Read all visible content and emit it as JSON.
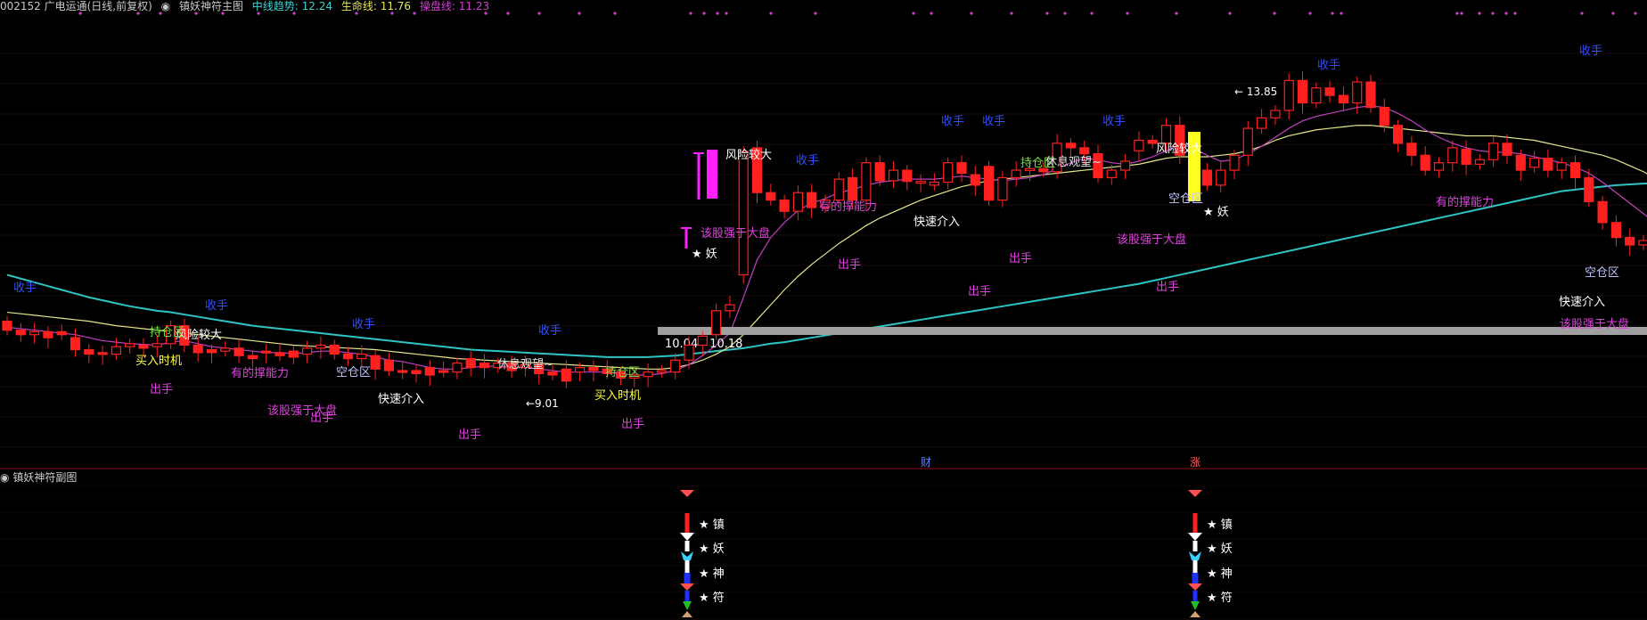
{
  "header": {
    "stock": "002152 广电运通(日线,前复权)",
    "indicator": "镇妖神符主图",
    "mid_trend": "中线趋势: 12.24",
    "life_line": "生命线: 11.76",
    "operate_line": "操盘线: 11.23"
  },
  "sub_chart_title": "镇妖神符副图",
  "range_label": "10.04 - 10.18",
  "price_high": "← 13.85",
  "price_low": "←9.01",
  "markers": {
    "cai": "财",
    "zhang": "涨"
  },
  "sub_labels": [
    "★ 镇",
    "★ 妖",
    "★ 神",
    "★ 符"
  ],
  "colors": {
    "up": "#ff2020",
    "down": "#ff2020",
    "cyan_line": "#2ec4c4",
    "yellow_line": "#e6e68c",
    "magenta_line": "#c040c0",
    "range_bar": "#a0a0a0",
    "header_mid": "#3ed0d0",
    "header_life": "#e6e65a",
    "header_op": "#d040d0"
  },
  "annotations": [
    {
      "text": "收手",
      "color": "#3050ff"
    },
    {
      "text": "收手",
      "color": "#3050ff"
    },
    {
      "text": "收手",
      "color": "#3050ff"
    },
    {
      "text": "收手",
      "color": "#3050ff"
    },
    {
      "text": "收手",
      "color": "#3050ff"
    },
    {
      "text": "收手",
      "color": "#3050ff"
    },
    {
      "text": "收手",
      "color": "#3050ff"
    },
    {
      "text": "收手",
      "color": "#3050ff"
    },
    {
      "text": "收手",
      "color": "#3050ff"
    },
    {
      "text": "收手",
      "color": "#3050ff"
    },
    {
      "text": "出手",
      "color": "#e040e0"
    },
    {
      "text": "出手",
      "color": "#e040e0"
    },
    {
      "text": "出手",
      "color": "#e040e0"
    },
    {
      "text": "出手",
      "color": "#e040e0"
    },
    {
      "text": "出手",
      "color": "#e040e0"
    },
    {
      "text": "出手",
      "color": "#e040e0"
    },
    {
      "text": "出手",
      "color": "#e040e0"
    },
    {
      "text": "出手",
      "color": "#e040e0"
    },
    {
      "text": "风险较大",
      "color": "#ffffff"
    },
    {
      "text": "风险较大",
      "color": "#ffffff"
    },
    {
      "text": "风险较大",
      "color": "#ffffff"
    },
    {
      "text": "持仓区",
      "color": "#70e040"
    },
    {
      "text": "持仓区",
      "color": "#70e040"
    },
    {
      "text": "持仓区",
      "color": "#70e040"
    },
    {
      "text": "空仓区",
      "color": "#c0c0ff"
    },
    {
      "text": "空仓区",
      "color": "#c0c0ff"
    },
    {
      "text": "空仓区",
      "color": "#c0c0ff"
    },
    {
      "text": "买入时机",
      "color": "#ffff40"
    },
    {
      "text": "买入时机",
      "color": "#ffff40"
    },
    {
      "text": "快速介入",
      "color": "#ffffff"
    },
    {
      "text": "快速介入",
      "color": "#ffffff"
    },
    {
      "text": "快速介入",
      "color": "#ffffff"
    },
    {
      "text": "休息观望~",
      "color": "#e0e0e0"
    },
    {
      "text": "休息观望~",
      "color": "#e0e0e0"
    },
    {
      "text": "该股强于大盘",
      "color": "#e040e0"
    },
    {
      "text": "该股强于大盘",
      "color": "#e040e0"
    },
    {
      "text": "该股强于大盘",
      "color": "#e040e0"
    },
    {
      "text": "该股强于大盘",
      "color": "#e040e0"
    },
    {
      "text": "有的撑能力",
      "color": "#e040e0"
    },
    {
      "text": "有的撑能力",
      "color": "#e040e0"
    },
    {
      "text": "有的撑能力",
      "color": "#e040e0"
    },
    {
      "text": "★ 妖",
      "color": "#ffffff"
    },
    {
      "text": "★ 妖",
      "color": "#ffffff"
    }
  ],
  "chart_data": {
    "type": "candlestick",
    "price_range": [
      8.6,
      14.2
    ],
    "candles": [
      [
        10.38,
        10.26
      ],
      [
        10.26,
        10.2
      ],
      [
        10.2,
        10.24
      ],
      [
        10.24,
        10.16
      ],
      [
        10.24,
        10.2
      ],
      [
        10.16,
        10.0
      ],
      [
        10.0,
        9.94
      ],
      [
        9.96,
        9.94
      ],
      [
        9.94,
        10.04
      ],
      [
        10.04,
        10.08
      ],
      [
        10.06,
        10.02
      ],
      [
        10.04,
        10.08
      ],
      [
        10.08,
        10.32
      ],
      [
        10.32,
        10.06
      ],
      [
        10.06,
        9.96
      ],
      [
        10.0,
        9.96
      ],
      [
        9.98,
        10.02
      ],
      [
        10.02,
        9.92
      ],
      [
        9.92,
        9.88
      ],
      [
        9.98,
        9.96
      ],
      [
        9.96,
        9.92
      ],
      [
        9.98,
        9.9
      ],
      [
        9.94,
        10.02
      ],
      [
        10.02,
        10.06
      ],
      [
        10.06,
        9.94
      ],
      [
        9.94,
        9.88
      ],
      [
        9.88,
        9.94
      ],
      [
        9.92,
        9.74
      ],
      [
        9.86,
        9.72
      ],
      [
        9.72,
        9.7
      ],
      [
        9.72,
        9.68
      ],
      [
        9.76,
        9.66
      ],
      [
        9.72,
        9.7
      ],
      [
        9.7,
        9.82
      ],
      [
        9.88,
        9.76
      ],
      [
        9.82,
        9.76
      ],
      [
        9.76,
        9.82
      ],
      [
        9.82,
        9.72
      ],
      [
        9.76,
        9.8
      ],
      [
        9.8,
        9.68
      ],
      [
        9.7,
        9.66
      ],
      [
        9.74,
        9.58
      ],
      [
        9.7,
        9.76
      ],
      [
        9.76,
        9.72
      ],
      [
        9.74,
        9.68
      ],
      [
        9.7,
        9.62
      ],
      [
        9.62,
        9.66
      ],
      [
        9.64,
        9.7
      ],
      [
        9.7,
        9.72
      ],
      [
        9.7,
        9.86
      ],
      [
        9.86,
        10.06
      ],
      [
        10.06,
        10.18
      ],
      [
        10.2,
        10.52
      ],
      [
        10.52,
        10.6
      ],
      [
        11.0,
        12.65
      ],
      [
        12.7,
        12.1
      ],
      [
        12.1,
        12.0
      ],
      [
        12.0,
        11.85
      ],
      [
        11.85,
        12.1
      ],
      [
        12.1,
        11.9
      ],
      [
        11.9,
        12.0
      ],
      [
        12.0,
        12.28
      ],
      [
        12.3,
        12.0
      ],
      [
        12.0,
        12.5
      ],
      [
        12.5,
        12.26
      ],
      [
        12.26,
        12.4
      ],
      [
        12.4,
        12.25
      ],
      [
        12.25,
        12.25
      ],
      [
        12.2,
        12.24
      ],
      [
        12.24,
        12.5
      ],
      [
        12.5,
        12.36
      ],
      [
        12.34,
        12.2
      ],
      [
        12.45,
        12.0
      ],
      [
        12.0,
        12.3
      ],
      [
        12.3,
        12.4
      ],
      [
        12.4,
        12.42
      ],
      [
        12.42,
        12.38
      ],
      [
        12.38,
        12.76
      ],
      [
        12.76,
        12.7
      ],
      [
        12.7,
        12.62
      ],
      [
        12.62,
        12.3
      ],
      [
        12.3,
        12.4
      ],
      [
        12.4,
        12.52
      ],
      [
        12.66,
        12.8
      ],
      [
        12.8,
        12.76
      ],
      [
        12.76,
        13.0
      ],
      [
        13.0,
        12.6
      ],
      [
        12.6,
        12.4
      ],
      [
        12.4,
        12.2
      ],
      [
        12.2,
        12.4
      ],
      [
        12.4,
        12.6
      ],
      [
        12.6,
        12.96
      ],
      [
        12.96,
        13.1
      ],
      [
        13.1,
        13.2
      ],
      [
        13.2,
        13.6
      ],
      [
        13.6,
        13.3
      ],
      [
        13.3,
        13.5
      ],
      [
        13.5,
        13.4
      ],
      [
        13.4,
        13.3
      ],
      [
        13.3,
        13.58
      ],
      [
        13.58,
        13.24
      ],
      [
        13.24,
        13.0
      ],
      [
        13.0,
        12.76
      ],
      [
        12.76,
        12.6
      ],
      [
        12.6,
        12.4
      ],
      [
        12.4,
        12.5
      ],
      [
        12.5,
        12.7
      ],
      [
        12.68,
        12.48
      ],
      [
        12.48,
        12.54
      ],
      [
        12.54,
        12.76
      ],
      [
        12.76,
        12.6
      ],
      [
        12.6,
        12.4
      ],
      [
        12.44,
        12.56
      ],
      [
        12.56,
        12.4
      ],
      [
        12.4,
        12.5
      ],
      [
        12.5,
        12.3
      ],
      [
        12.3,
        11.98
      ],
      [
        11.98,
        11.7
      ],
      [
        11.7,
        11.5
      ],
      [
        11.5,
        11.4
      ],
      [
        11.4,
        11.46
      ],
      [
        11.46,
        11.4
      ],
      [
        11.4,
        11.36
      ],
      [
        11.36,
        11.44
      ],
      [
        11.44,
        11.4
      ]
    ],
    "series": [
      {
        "name": "中线趋势",
        "values": [
          11.0,
          10.95,
          10.9,
          10.85,
          10.8,
          10.75,
          10.7,
          10.66,
          10.62,
          10.58,
          10.55,
          10.52,
          10.5,
          10.47,
          10.44,
          10.41,
          10.38,
          10.35,
          10.32,
          10.3,
          10.28,
          10.26,
          10.24,
          10.22,
          10.2,
          10.18,
          10.16,
          10.14,
          10.12,
          10.1,
          10.08,
          10.06,
          10.04,
          10.02,
          10.0,
          9.99,
          9.98,
          9.97,
          9.96,
          9.95,
          9.94,
          9.93,
          9.92,
          9.91,
          9.9,
          9.9,
          9.9,
          9.9,
          9.91,
          9.92,
          9.94,
          9.96,
          9.98,
          10.0,
          10.02,
          10.05,
          10.08,
          10.1,
          10.13,
          10.16,
          10.19,
          10.22,
          10.25,
          10.28,
          10.31,
          10.34,
          10.37,
          10.4,
          10.43,
          10.46,
          10.49,
          10.52,
          10.55,
          10.58,
          10.61,
          10.64,
          10.67,
          10.7,
          10.73,
          10.76,
          10.79,
          10.82,
          10.85,
          10.88,
          10.92,
          10.96,
          11.0,
          11.04,
          11.08,
          11.12,
          11.16,
          11.2,
          11.24,
          11.28,
          11.32,
          11.36,
          11.4,
          11.44,
          11.48,
          11.52,
          11.56,
          11.6,
          11.64,
          11.68,
          11.72,
          11.76,
          11.8,
          11.84,
          11.88,
          11.92,
          11.96,
          12.0,
          12.04,
          12.08,
          12.12,
          12.14,
          12.16,
          12.18,
          12.2,
          12.21,
          12.22,
          12.23,
          12.24,
          12.24,
          12.24
        ]
      },
      {
        "name": "生命线",
        "values": [
          10.5,
          10.48,
          10.46,
          10.44,
          10.42,
          10.4,
          10.38,
          10.35,
          10.32,
          10.3,
          10.28,
          10.26,
          10.24,
          10.22,
          10.2,
          10.18,
          10.16,
          10.14,
          10.12,
          10.1,
          10.08,
          10.06,
          10.05,
          10.04,
          10.03,
          10.02,
          10.01,
          10.0,
          9.98,
          9.96,
          9.94,
          9.92,
          9.9,
          9.88,
          9.87,
          9.86,
          9.85,
          9.84,
          9.83,
          9.82,
          9.81,
          9.8,
          9.79,
          9.78,
          9.77,
          9.76,
          9.75,
          9.74,
          9.74,
          9.76,
          9.8,
          9.86,
          9.94,
          10.04,
          10.2,
          10.4,
          10.6,
          10.8,
          10.98,
          11.14,
          11.28,
          11.42,
          11.54,
          11.66,
          11.76,
          11.84,
          11.92,
          12.0,
          12.06,
          12.12,
          12.18,
          12.22,
          12.26,
          12.28,
          12.3,
          12.32,
          12.34,
          12.36,
          12.38,
          12.4,
          12.42,
          12.44,
          12.46,
          12.48,
          12.52,
          12.56,
          12.58,
          12.58,
          12.58,
          12.6,
          12.62,
          12.66,
          12.72,
          12.8,
          12.86,
          12.9,
          12.94,
          12.96,
          12.98,
          13.0,
          13.0,
          12.98,
          12.96,
          12.94,
          12.92,
          12.9,
          12.88,
          12.86,
          12.86,
          12.86,
          12.84,
          12.82,
          12.8,
          12.76,
          12.72,
          12.68,
          12.64,
          12.6,
          12.54,
          12.46,
          12.38,
          12.28,
          12.16,
          12.04,
          11.92
        ]
      },
      {
        "name": "操盘线",
        "values": [
          10.3,
          10.28,
          10.26,
          10.24,
          10.22,
          10.2,
          10.16,
          10.12,
          10.1,
          10.08,
          10.07,
          10.06,
          10.1,
          10.12,
          10.08,
          10.04,
          10.02,
          10.0,
          9.98,
          9.96,
          9.96,
          9.95,
          9.96,
          9.98,
          9.98,
          9.96,
          9.94,
          9.9,
          9.86,
          9.84,
          9.8,
          9.76,
          9.74,
          9.74,
          9.76,
          9.78,
          9.78,
          9.76,
          9.76,
          9.74,
          9.72,
          9.7,
          9.7,
          9.7,
          9.7,
          9.68,
          9.66,
          9.66,
          9.68,
          9.72,
          9.8,
          9.92,
          10.06,
          10.22,
          10.7,
          11.2,
          11.5,
          11.7,
          11.86,
          11.96,
          12.02,
          12.1,
          12.14,
          12.2,
          12.24,
          12.26,
          12.28,
          12.28,
          12.28,
          12.3,
          12.32,
          12.3,
          12.28,
          12.26,
          12.28,
          12.3,
          12.34,
          12.42,
          12.5,
          12.56,
          12.54,
          12.5,
          12.48,
          12.52,
          12.58,
          12.66,
          12.74,
          12.7,
          12.6,
          12.52,
          12.54,
          12.62,
          12.72,
          12.84,
          12.96,
          13.06,
          13.12,
          13.16,
          13.2,
          13.24,
          13.26,
          13.24,
          13.16,
          13.06,
          12.94,
          12.84,
          12.76,
          12.7,
          12.66,
          12.64,
          12.64,
          12.62,
          12.58,
          12.54,
          12.5,
          12.44,
          12.36,
          12.24,
          12.1,
          11.96,
          11.82,
          11.68,
          11.58,
          11.5,
          11.44
        ]
      }
    ]
  }
}
